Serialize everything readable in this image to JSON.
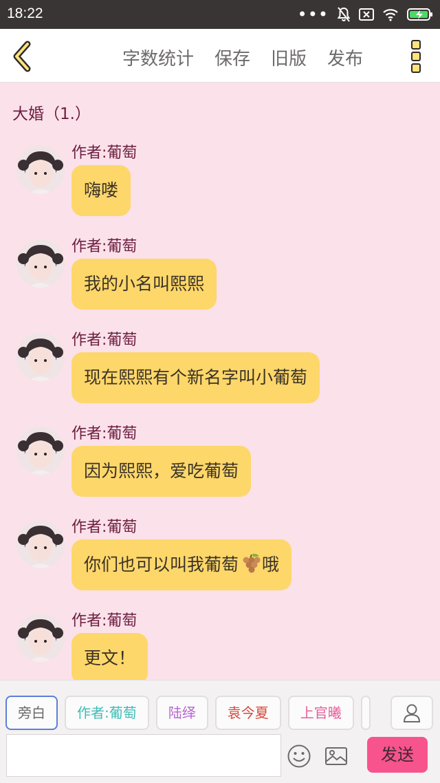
{
  "status_bar": {
    "time": "18:22"
  },
  "toolbar": {
    "menu": [
      "字数统计",
      "保存",
      "旧版",
      "发布"
    ]
  },
  "chapter_title": "大婚（1.）",
  "messages": [
    {
      "author": "作者:葡萄",
      "text": "嗨喽"
    },
    {
      "author": "作者:葡萄",
      "text": "我的小名叫熙熙"
    },
    {
      "author": "作者:葡萄",
      "text": "现在熙熙有个新名字叫小葡萄"
    },
    {
      "author": "作者:葡萄",
      "text": "因为熙熙，爱吃葡萄"
    },
    {
      "author": "作者:葡萄",
      "text": "你们也可以叫我葡萄",
      "text_after_emoji": "哦",
      "emoji": "grape-icon"
    },
    {
      "author": "作者:葡萄",
      "text": "更文！"
    }
  ],
  "roles": [
    "旁白",
    "作者:葡萄",
    "陆绎",
    "袁今夏",
    "上官曦"
  ],
  "composer": {
    "input_value": "",
    "send_label": "发送"
  },
  "colors": {
    "background": "#fbe1ea",
    "bubble": "#fdd76a",
    "send_button": "#f7538d",
    "author_text": "#6b1d3e"
  }
}
